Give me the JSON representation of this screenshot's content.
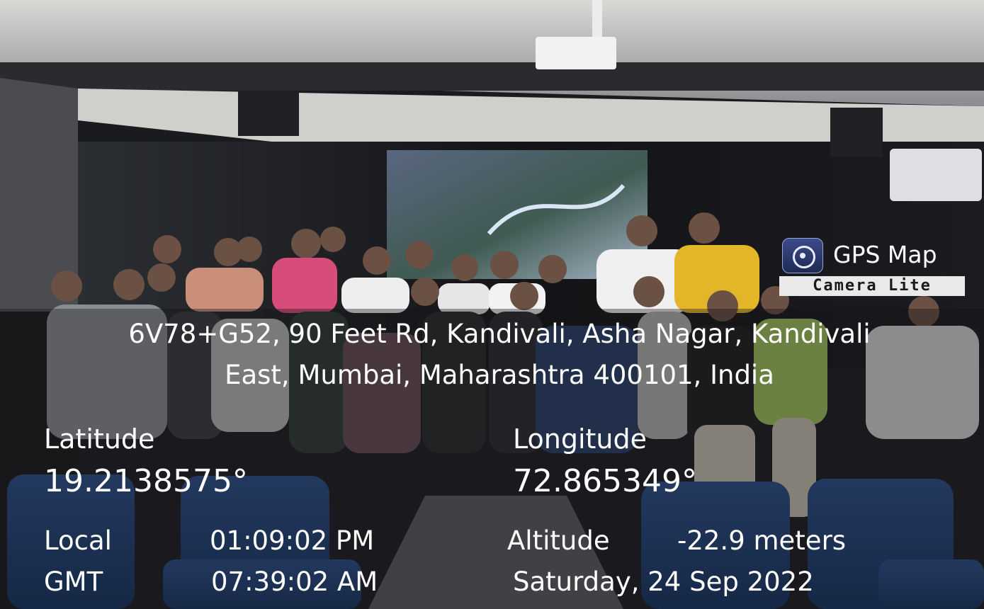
{
  "watermark": {
    "app_name": "GPS Map",
    "app_sub": "Camera Lite",
    "icon": "camera-lens-icon"
  },
  "address": {
    "line1": "6V78+G52, 90 Feet Rd, Kandivali, Asha Nagar, Kandivali",
    "line2": "East, Mumbai, Maharashtra 400101, India"
  },
  "coords": {
    "latitude_label": "Latitude",
    "latitude_value": "19.2138575°",
    "longitude_label": "Longitude",
    "longitude_value": "72.865349°"
  },
  "time": {
    "local_label": "Local",
    "local_value": "01:09:02 PM",
    "gmt_label": "GMT",
    "gmt_value": "07:39:02 AM"
  },
  "meta": {
    "altitude_label": "Altitude",
    "altitude_value": "-22.9 meters",
    "date": "Saturday, 24 Sep 2022"
  }
}
